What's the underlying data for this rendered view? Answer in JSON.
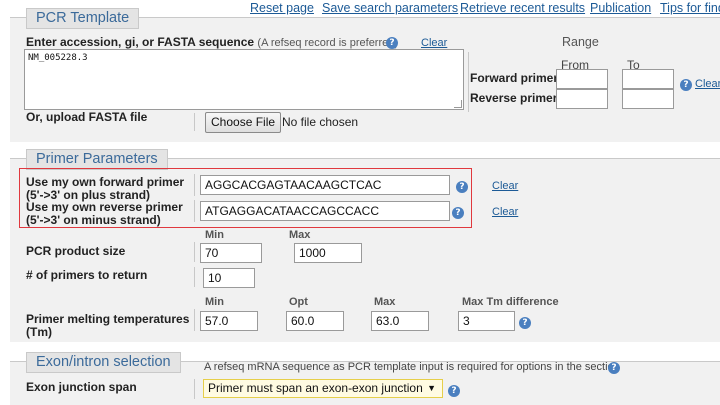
{
  "top_links": [
    "Reset page",
    "Save search parameters",
    "Retrieve recent results",
    "Publication",
    "Tips for find"
  ],
  "pcr_template": {
    "title": "PCR Template",
    "entry_label": "Enter accession, gi, or FASTA sequence",
    "entry_note": "(A refseq record is preferred)",
    "clear_label": "Clear",
    "sequence_value": "NM_005228.3",
    "range_title": "Range",
    "from_label": "From",
    "to_label": "To",
    "forward_label": "Forward primer",
    "reverse_label": "Reverse primer",
    "range_clear_label": "Clear",
    "upload_label": "Or, upload FASTA file",
    "choose_file_label": "Choose File",
    "no_file_label": "No file chosen"
  },
  "primer_params": {
    "title": "Primer Parameters",
    "forward_own_label": "Use my own forward primer",
    "forward_own_sub": "(5'->3' on plus strand)",
    "forward_value": "AGGCACGAGTAACAAGCTCAC",
    "reverse_own_label": "Use my own reverse primer",
    "reverse_own_sub": "(5'->3' on minus strand)",
    "reverse_value": "ATGAGGACATAACCAGCCACC",
    "clear_label": "Clear",
    "min_label": "Min",
    "max_label": "Max",
    "product_size_label": "PCR product size",
    "product_min": "70",
    "product_max": "1000",
    "num_primers_label": "# of primers to return",
    "num_primers_value": "10",
    "tm_min_label": "Min",
    "tm_opt_label": "Opt",
    "tm_max_label": "Max",
    "tm_diff_label": "Max Tm difference",
    "tm_label_line1": "Primer melting temperatures",
    "tm_label_line2": "(Tm)",
    "tm_min": "57.0",
    "tm_opt": "60.0",
    "tm_max": "63.0",
    "tm_diff": "3"
  },
  "exon": {
    "title": "Exon/intron selection",
    "note": "A refseq mRNA sequence as PCR template input is required for options in the section",
    "junction_label": "Exon junction span",
    "junction_value": "Primer must span an exon-exon junction"
  },
  "colors": {
    "link": "#1c5a96",
    "section_bg": "#f1f1f1",
    "highlight_box": "#e0383e",
    "help_icon": "#4a7fbf"
  },
  "icons": [
    "help-icon",
    "dropdown-arrow-icon"
  ]
}
